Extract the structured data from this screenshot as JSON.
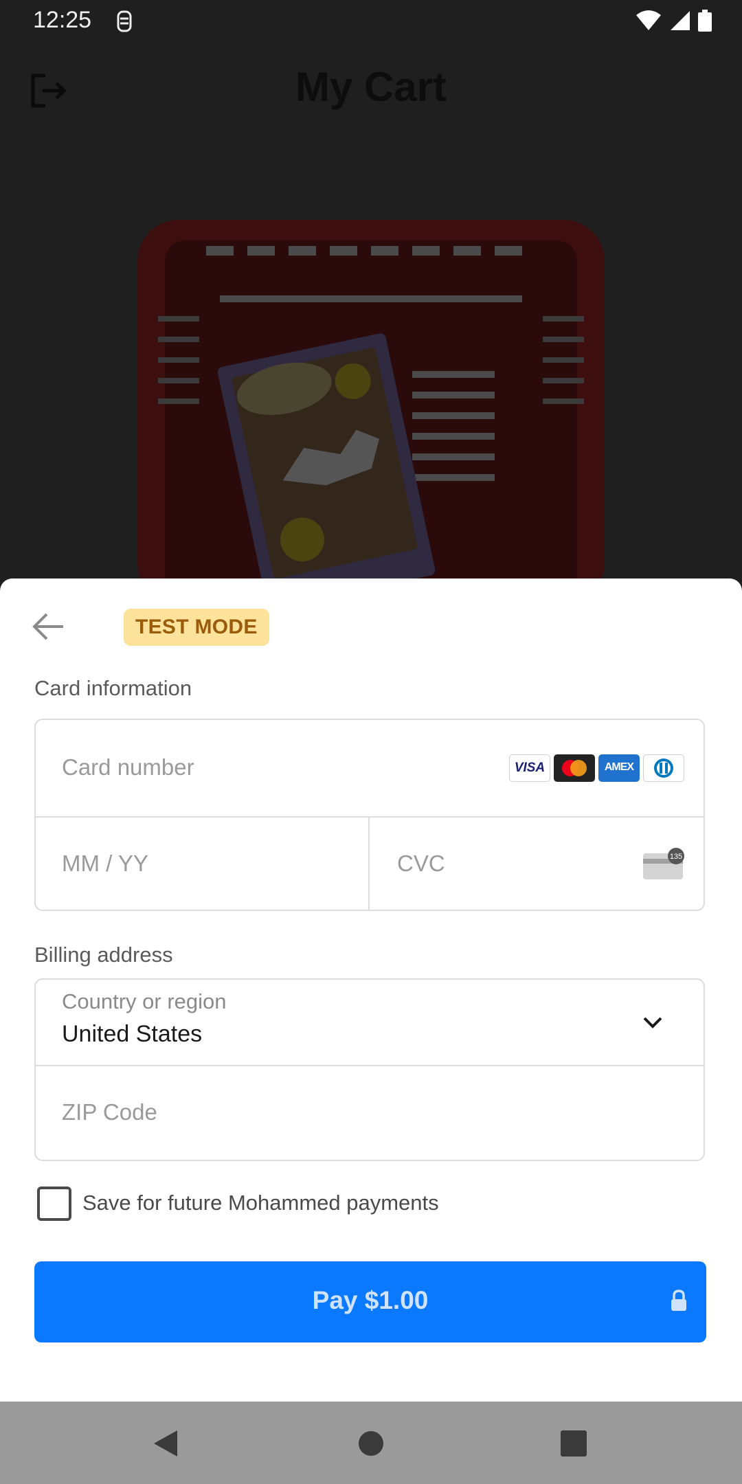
{
  "status_bar": {
    "time": "12:25"
  },
  "app": {
    "title": "My Cart"
  },
  "sheet": {
    "badge": "TEST MODE",
    "card_section_label": "Card information",
    "card_number_placeholder": "Card number",
    "card_brands": [
      "VISA",
      "mastercard",
      "AMEX",
      "diners-club"
    ],
    "expiry_placeholder": "MM / YY",
    "cvc_placeholder": "CVC",
    "cvc_icon_text": "135",
    "billing_section_label": "Billing address",
    "country_label": "Country or region",
    "country_value": "United States",
    "zip_placeholder": "ZIP Code",
    "save_label": "Save for future Mohammed payments",
    "save_checked": false,
    "pay_label": "Pay $1.00"
  },
  "colors": {
    "pay_button": "#0a79ff",
    "badge_bg": "#fde29b",
    "badge_text": "#9a5c0a",
    "scrim": "#1f1f1f"
  }
}
